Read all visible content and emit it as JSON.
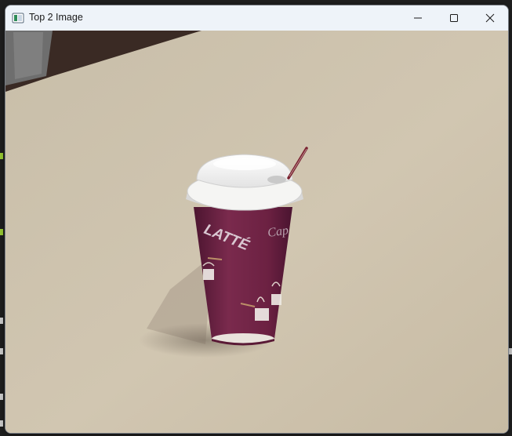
{
  "window": {
    "title": "Top 2 Image",
    "icon": "image-window-icon",
    "controls": [
      "minimize-icon",
      "maximize-icon",
      "close-icon"
    ]
  },
  "image": {
    "description_icon": "photo",
    "cup_text": "LATTÉ",
    "colors": {
      "table": "#cbbfa9",
      "cup": "#6f2343",
      "lid": "#f3f3f1"
    }
  }
}
